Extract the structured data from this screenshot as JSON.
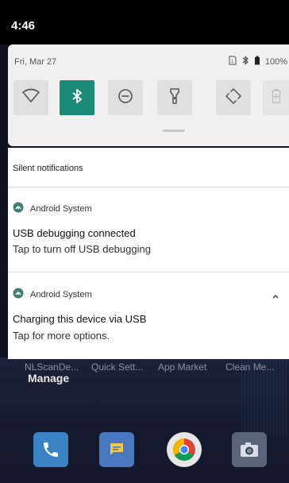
{
  "status_bar": {
    "time": "4:46"
  },
  "quick_settings": {
    "date": "Fri, Mar 27",
    "battery_percent": "100%",
    "tiles": [
      {
        "name": "wifi",
        "icon": "wifi-icon",
        "active": false
      },
      {
        "name": "bluetooth",
        "icon": "bluetooth-icon",
        "active": true
      },
      {
        "name": "do-not-disturb",
        "icon": "dnd-icon",
        "active": false
      },
      {
        "name": "flashlight",
        "icon": "flashlight-icon",
        "active": false
      },
      {
        "name": "auto-rotate",
        "icon": "rotate-icon",
        "active": false
      },
      {
        "name": "battery-saver",
        "icon": "battery-saver-icon",
        "active": false
      }
    ],
    "accent_color": "#1b8a77"
  },
  "notifications": {
    "section_header": "Silent notifications",
    "items": [
      {
        "app": "Android System",
        "title": "USB debugging connected",
        "text": "Tap to turn off USB debugging"
      },
      {
        "app": "Android System",
        "title": "Charging this device via USB",
        "text": "Tap for more options."
      }
    ]
  },
  "home": {
    "app_labels": [
      "NLScanDe...",
      "Quick Sett...",
      "App Market",
      "Clean Me..."
    ],
    "manage_label": "Manage",
    "dock": [
      {
        "name": "phone",
        "icon": "phone-icon"
      },
      {
        "name": "messages",
        "icon": "messages-icon"
      },
      {
        "name": "chrome",
        "icon": "chrome-icon"
      },
      {
        "name": "camera",
        "icon": "camera-icon"
      }
    ]
  }
}
